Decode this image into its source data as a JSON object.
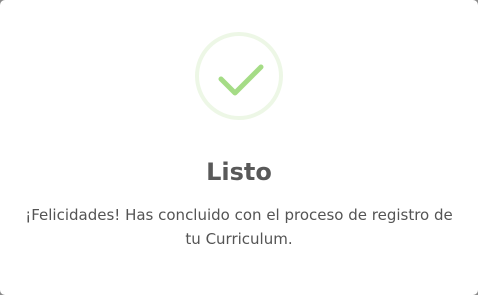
{
  "dialog": {
    "icon": "success-check-icon",
    "icon_color": "#a5dc86",
    "icon_ring_color": "#edf7e6",
    "title": "Listo",
    "message": "¡Felicidades! Has concluido con el proceso de registro de tu Curriculum."
  }
}
